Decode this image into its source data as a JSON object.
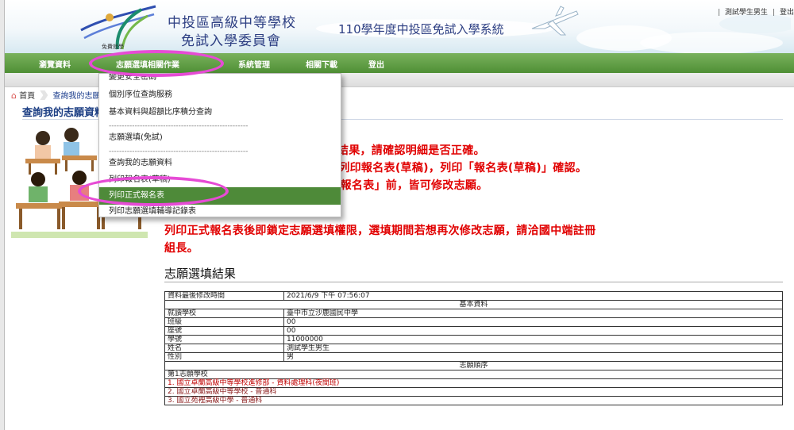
{
  "header": {
    "org_line1": "中投區高級中等學校",
    "org_line2": "免試入學委員會",
    "system_title": "110學年度中投區免試入學系統",
    "top_user": "測試學生男生",
    "top_logout": "登出",
    "logo_caption": "免費就學"
  },
  "nav": {
    "items": [
      {
        "label": "瀏覽資料"
      },
      {
        "label": "志願選填相關作業"
      },
      {
        "label": "系統管理"
      },
      {
        "label": "相關下載"
      },
      {
        "label": "登出"
      }
    ]
  },
  "dropdown": {
    "items": [
      {
        "label": "變更安全密碼"
      },
      {
        "label": "個別序位查詢服務"
      },
      {
        "label": "基本資料與超額比序積分查詢"
      },
      {
        "label": "志願選填(免試)"
      },
      {
        "label": "查詢我的志願資料"
      },
      {
        "label": "列印報名表(草稿)"
      },
      {
        "label": "列印正式報名表"
      },
      {
        "label": "列印志願選填輔導記錄表"
      }
    ],
    "separator": "------------------------------------------------------"
  },
  "breadcrumb": {
    "home": "首頁",
    "current": "查詢我的志願資料"
  },
  "page": {
    "title": "查詢我的志願資料",
    "notes": [
      "顯選填結果，請確認明細是否正確。",
      "長→列印報名表(草稿)，列印「報名表(草稿)」確認。",
      "正式報名表」前，皆可修改志願。",
      "列印正式報名表後即鎖定志願選填權限，選填期間若想再次修改志願，請洽國中端註冊",
      "組長。"
    ],
    "section_title": "志願選填結果"
  },
  "table": {
    "last_modified_label": "資料最後修改時間",
    "last_modified_value": "2021/6/9 下午 07:56:07",
    "basic_header": "基本資料",
    "basic_rows": [
      {
        "label": "就讀學校",
        "value": "臺中市立沙鹿國民中學"
      },
      {
        "label": "班級",
        "value": "00"
      },
      {
        "label": "座號",
        "value": "00"
      },
      {
        "label": "學號",
        "value": "11000000"
      },
      {
        "label": "姓名",
        "value": "測試學生男生"
      },
      {
        "label": "性別",
        "value": "男"
      }
    ],
    "order_header": "志願順序",
    "first_choice_label": "第1志願學校",
    "choices": [
      "1. 國立卓蘭高級中等學校進修部 - 資料處理科(夜間班)",
      "2. 國立卓蘭高級中等學校 - 普通科",
      "3. 國立苑裡高級中學 - 普通科"
    ]
  },
  "colors": {
    "nav_green": "#5a9a3e",
    "active_green": "#4e8a39",
    "title_blue": "#1d3f84",
    "notice_red": "#e10000",
    "highlight_magenta": "#e64bd5"
  }
}
